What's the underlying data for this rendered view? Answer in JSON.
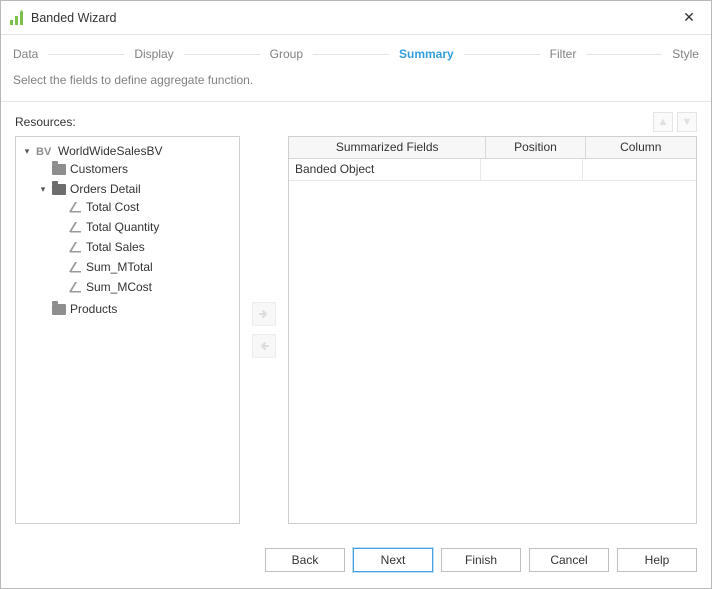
{
  "window": {
    "title": "Banded Wizard",
    "close_glyph": "✕"
  },
  "steps": {
    "items": [
      "Data",
      "Display",
      "Group",
      "Summary",
      "Filter",
      "Style"
    ],
    "active_index": 3
  },
  "instruction": "Select the fields to define aggregate function.",
  "resources_label": "Resources:",
  "tree": {
    "root": {
      "label": "WorldWideSalesBV",
      "children": [
        {
          "label": "Customers",
          "type": "folder",
          "expanded": false
        },
        {
          "label": "Orders Detail",
          "type": "folder",
          "expanded": true,
          "children": [
            {
              "label": "Total Cost",
              "type": "field"
            },
            {
              "label": "Total Quantity",
              "type": "field"
            },
            {
              "label": "Total Sales",
              "type": "field"
            },
            {
              "label": "Sum_MTotal",
              "type": "field"
            },
            {
              "label": "Sum_MCost",
              "type": "field"
            }
          ]
        },
        {
          "label": "Products",
          "type": "folder",
          "expanded": false
        }
      ]
    }
  },
  "transfer": {
    "right_glyph": "➔",
    "left_glyph": "➔"
  },
  "updown": {
    "up_glyph": "▲",
    "down_glyph": "▼"
  },
  "table": {
    "columns": [
      "Summarized Fields",
      "Position",
      "Column"
    ],
    "rows": [
      {
        "summarized": "Banded Object",
        "position": "",
        "column": ""
      }
    ]
  },
  "buttons": {
    "back": "Back",
    "next": "Next",
    "finish": "Finish",
    "cancel": "Cancel",
    "help": "Help"
  }
}
